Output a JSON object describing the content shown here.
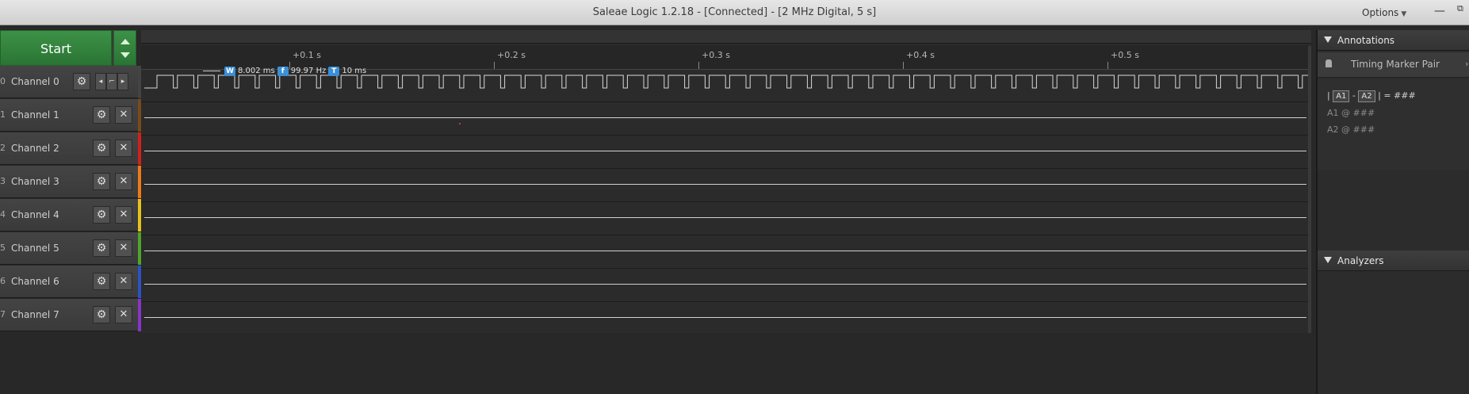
{
  "window": {
    "title": "Saleae Logic 1.2.18 - [Connected] - [2 MHz Digital, 5 s]",
    "options_label": "Options",
    "minimize_glyph": "—",
    "maximize_glyph": "⧉"
  },
  "start": {
    "label": "Start",
    "color": "#2f7d38"
  },
  "time_ruler": {
    "ticks": [
      "+0.1 s",
      "+0.2 s",
      "+0.3 s",
      "+0.4 s",
      "+0.5 s"
    ]
  },
  "measurements": {
    "width_badge": "W",
    "width_value": "8.002 ms",
    "freq_badge": "f",
    "freq_value": "99.97 Hz",
    "period_badge": "T",
    "period_value": "10 ms"
  },
  "channels": [
    {
      "num": "0",
      "name": "Channel 0",
      "color": "#444444",
      "signal": "square",
      "icon_gear": "gear-icon",
      "icon_close": "close-icon"
    },
    {
      "num": "1",
      "name": "Channel 1",
      "color": "#7a4a1a",
      "signal": "flat",
      "icon_gear": "gear-icon",
      "icon_close": "close-icon"
    },
    {
      "num": "2",
      "name": "Channel 2",
      "color": "#d4201c",
      "signal": "flat",
      "icon_gear": "gear-icon",
      "icon_close": "close-icon"
    },
    {
      "num": "3",
      "name": "Channel 3",
      "color": "#ee7a18",
      "signal": "flat",
      "icon_gear": "gear-icon",
      "icon_close": "close-icon"
    },
    {
      "num": "4",
      "name": "Channel 4",
      "color": "#e8c21a",
      "signal": "flat",
      "icon_gear": "gear-icon",
      "icon_close": "close-icon"
    },
    {
      "num": "5",
      "name": "Channel 5",
      "color": "#4ea52a",
      "signal": "flat",
      "icon_gear": "gear-icon",
      "icon_close": "close-icon"
    },
    {
      "num": "6",
      "name": "Channel 6",
      "color": "#2a53c4",
      "signal": "flat",
      "icon_gear": "gear-icon",
      "icon_close": "close-icon"
    },
    {
      "num": "7",
      "name": "Channel 7",
      "color": "#8a33c8",
      "signal": "flat",
      "icon_gear": "gear-icon",
      "icon_close": "close-icon"
    }
  ],
  "annotations": {
    "header": "Annotations",
    "marker_pair_label": "Timing Marker Pair",
    "a1": "A1",
    "a2": "A2",
    "minus": "-",
    "equals": "= ###",
    "a1_line": "A1  @  ###",
    "a2_line": "A2  @  ###"
  },
  "analyzers": {
    "header": "Analyzers"
  }
}
